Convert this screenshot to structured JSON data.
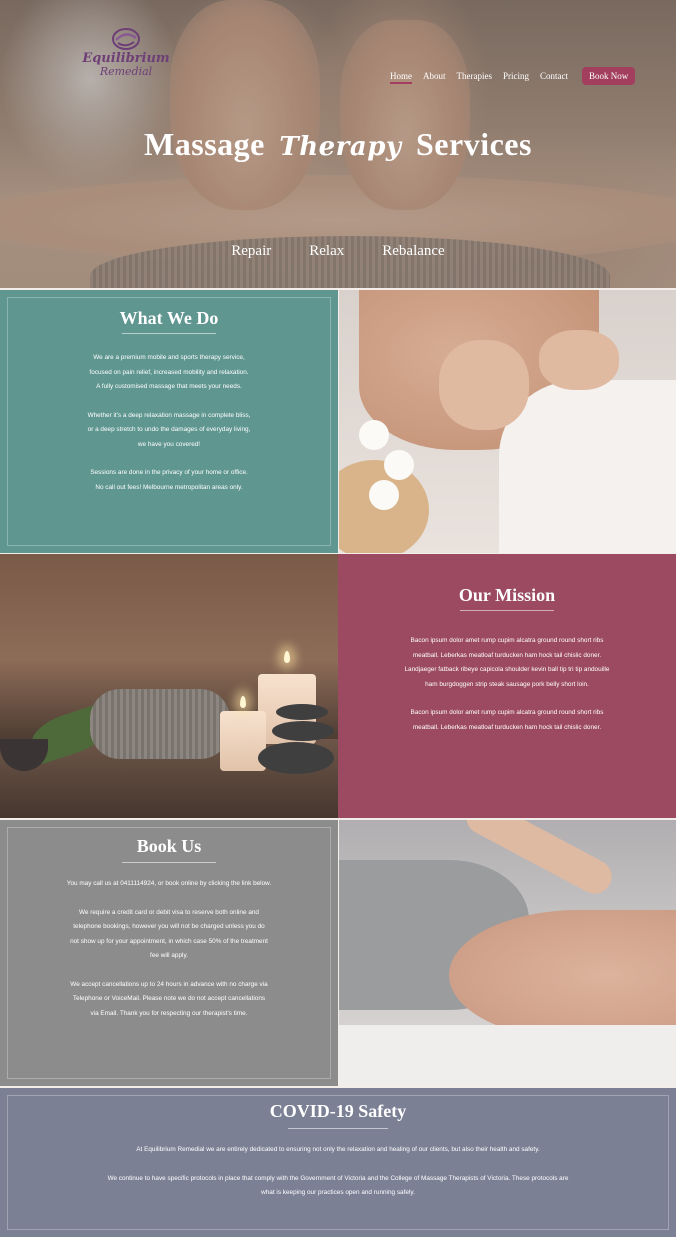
{
  "brand": {
    "line1": "Equilibrium",
    "line2": "Remedial",
    "color": "#6e3f77"
  },
  "nav": {
    "items": [
      "Home",
      "About",
      "Therapies",
      "Pricing",
      "Contact"
    ],
    "active": "Home",
    "book_label": "Book Now",
    "accent": "#a23f5f"
  },
  "hero": {
    "title_left": "Massage",
    "title_script": "Therapy",
    "title_right": "Services",
    "taglines": [
      "Repair",
      "Relax",
      "Rebalance"
    ]
  },
  "what_we_do": {
    "title": "What We Do",
    "paragraphs": [
      [
        "We are a premium mobile and sports therapy service,",
        "focused on pain relief, increased mobility and relaxation.",
        "A fully customised massage that meets your needs."
      ],
      [
        "Whether it's a deep relaxation massage in complete bliss,",
        "or a deep stretch to undo the damages of everyday living,",
        "we have you covered!"
      ],
      [
        "Sessions are done in the privacy of your home or office.",
        "No call out fees! Melbourne metropolitan areas only."
      ]
    ],
    "color": "#5f9690"
  },
  "our_mission": {
    "title": "Our Mission",
    "paragraphs": [
      [
        "Bacon ipsum dolor amet rump cupim alcatra ground round short ribs",
        "meatball. Leberkas meatloaf turducken ham hock tail chislic doner.",
        "Landjaeger fatback ribeye capicola shoulder kevin ball tip tri tip andouille",
        "ham burgdoggen strip steak sausage pork belly short loin."
      ],
      [
        "Bacon ipsum dolor amet rump cupim alcatra ground round short ribs",
        "meatball. Leberkas meatloaf turducken ham hock tail chislic doner."
      ]
    ],
    "color": "#9b4a62"
  },
  "book_us": {
    "title": "Book Us",
    "paragraphs": [
      [
        "You may call us at 0411114924, or book online by clicking the link below."
      ],
      [
        "We require a credit card or debit visa to reserve both online and",
        "telephone bookings, however you will not be charged unless you do",
        "not show up for your appointment, in which case 50% of the treatment",
        "fee will apply."
      ],
      [
        "We accept cancellations up to 24 hours in advance with no charge via",
        "Telephone or VoiceMail.  Please note we do not accept cancellations",
        "via Email.  Thank you for respecting our therapist's time."
      ]
    ],
    "color": "#8c8c8c"
  },
  "covid": {
    "title": "COVID-19 Safety",
    "paragraphs": [
      [
        "At Equilibrium Remedial we are entirely dedicated to ensuring not only the relaxation and healing of our clients, but also their health and safety."
      ],
      [
        "We continue to have specific protocols in place that comply with the Government of Victoria and the College of Massage Therapists of Victoria. These protocols are",
        "what is keeping our practices open and running safely."
      ]
    ],
    "color": "#7b8095"
  }
}
